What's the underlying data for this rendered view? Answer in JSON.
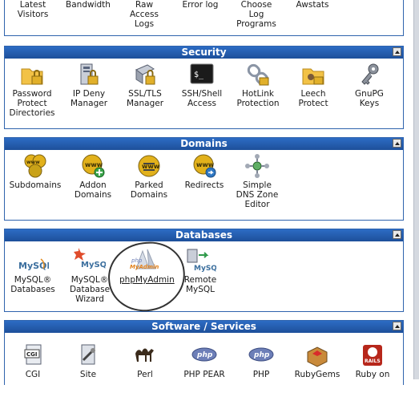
{
  "stats_row": {
    "items": [
      {
        "label": "Latest\nVisitors",
        "icon": "latest-visitors-icon"
      },
      {
        "label": "Bandwidth",
        "icon": "bandwidth-icon"
      },
      {
        "label": "Raw\nAccess\nLogs",
        "icon": "raw-access-logs-icon"
      },
      {
        "label": "Error log",
        "icon": "error-log-icon"
      },
      {
        "label": "Choose\nLog\nPrograms",
        "icon": "choose-log-programs-icon"
      },
      {
        "label": "Awstats",
        "icon": "awstats-icon"
      }
    ]
  },
  "security": {
    "title": "Security",
    "items": [
      {
        "label": "Password\nProtect\nDirectories",
        "icon": "folder-lock-icon"
      },
      {
        "label": "IP Deny\nManager",
        "icon": "ip-deny-icon"
      },
      {
        "label": "SSL/TLS\nManager",
        "icon": "ssl-certificate-icon"
      },
      {
        "label": "SSH/Shell\nAccess",
        "icon": "terminal-icon"
      },
      {
        "label": "HotLink\nProtection",
        "icon": "hotlink-chain-icon"
      },
      {
        "label": "Leech\nProtect",
        "icon": "leech-folder-icon"
      },
      {
        "label": "GnuPG\nKeys",
        "icon": "keys-icon"
      }
    ]
  },
  "domains": {
    "title": "Domains",
    "items": [
      {
        "label": "Subdomains",
        "icon": "subdomains-www-icon"
      },
      {
        "label": "Addon\nDomains",
        "icon": "addon-domains-www-icon"
      },
      {
        "label": "Parked\nDomains",
        "icon": "parked-domains-www-icon"
      },
      {
        "label": "Redirects",
        "icon": "redirects-www-icon"
      },
      {
        "label": "Simple\nDNS Zone\nEditor",
        "icon": "dns-zone-icon"
      }
    ]
  },
  "databases": {
    "title": "Databases",
    "items": [
      {
        "label": "MySQL®\nDatabases",
        "icon": "mysql-icon"
      },
      {
        "label": "MySQL®\nDatabase\nWizard",
        "icon": "mysql-wizard-icon"
      },
      {
        "label": "phpMyAdmin",
        "icon": "phpmyadmin-icon"
      },
      {
        "label": "Remote\nMySQL",
        "icon": "remote-mysql-icon"
      }
    ]
  },
  "software": {
    "title": "Software / Services",
    "items": [
      {
        "label": "CGI",
        "icon": "cgi-icon"
      },
      {
        "label": "Site",
        "icon": "site-software-icon"
      },
      {
        "label": "Perl",
        "icon": "perl-camel-icon"
      },
      {
        "label": "PHP PEAR",
        "icon": "php-pear-icon"
      },
      {
        "label": "PHP",
        "icon": "php-icon"
      },
      {
        "label": "RubyGems",
        "icon": "rubygems-icon"
      },
      {
        "label": "Ruby on",
        "icon": "ruby-on-rails-icon"
      }
    ]
  },
  "icon_text": {
    "mysql": "MySQL",
    "php": "php",
    "myadmin": "MyAdmin",
    "www": "www",
    "cgi": "CGI",
    "rails": "RAILS",
    "shell": "$_"
  },
  "colors": {
    "header_blue": "#1d4f9a",
    "panel_border": "#2f63ad",
    "link_blue": "#3b5fb8"
  }
}
